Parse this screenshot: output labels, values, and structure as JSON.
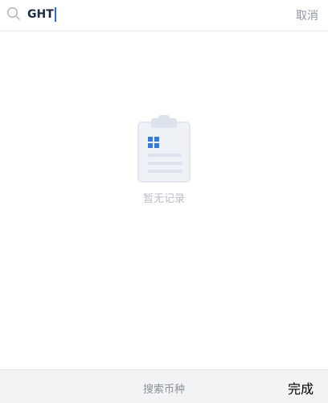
{
  "search": {
    "value": "GHT",
    "cancel_label": "取消"
  },
  "empty_state": {
    "message": "暂无记录",
    "icon": "clipboard-icon"
  },
  "bottom_bar": {
    "placeholder": "搜索币种",
    "done_label": "完成"
  },
  "colors": {
    "caret": "#2c6fd0",
    "accent": "#3a78d6",
    "muted": "#b8bdc6"
  }
}
